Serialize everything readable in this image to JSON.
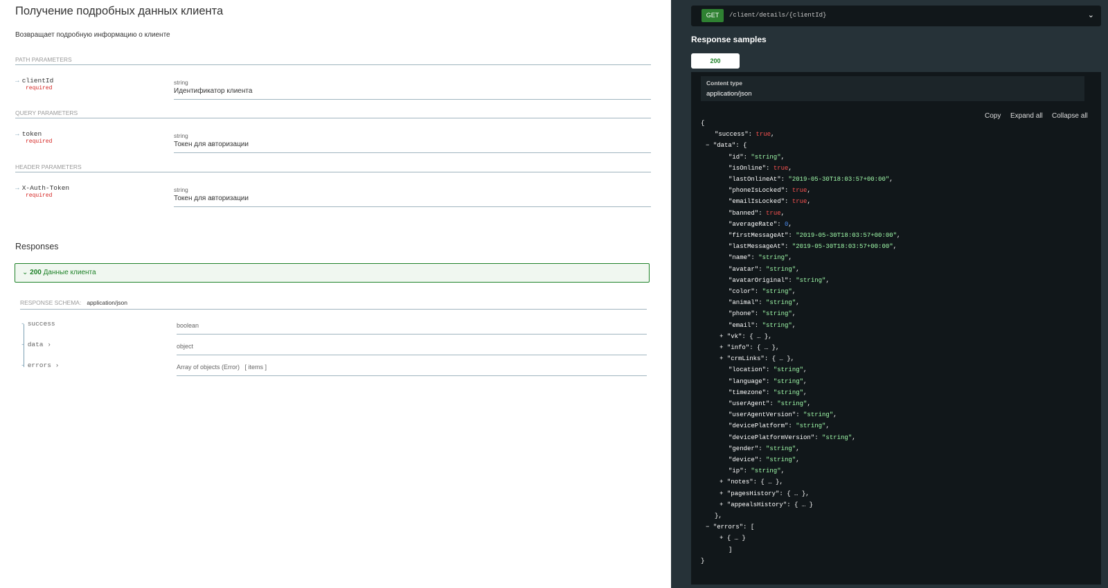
{
  "page": {
    "title": "Получение подробных данных клиента",
    "description": "Возвращает подробную информацию о клиенте"
  },
  "path_params": {
    "caption": "PATH PARAMETERS",
    "name": "clientId",
    "required": "required",
    "type": "string",
    "description": "Идентификатор клиента"
  },
  "query_params": {
    "caption": "QUERY PARAMETERS",
    "name": "token",
    "required": "required",
    "type": "string",
    "description": "Токен для авторизации"
  },
  "header_params": {
    "caption": "HEADER PARAMETERS",
    "name": "X-Auth-Token",
    "required": "required",
    "type": "string",
    "description": "Токен для авторизации"
  },
  "responses": {
    "title": "Responses",
    "code": "200",
    "label": "Данные клиента",
    "schema_label": "RESPONSE SCHEMA:",
    "schema_type": "application/json",
    "props": [
      {
        "name": "success",
        "type": "boolean"
      },
      {
        "name": "data",
        "type": "object"
      },
      {
        "name": "errors",
        "type": "Array of objects (Error)   [ items ]"
      }
    ]
  },
  "endpoint": {
    "method": "GET",
    "path": "/client/details/{clientId}"
  },
  "samples": {
    "title": "Response samples",
    "tab": "200",
    "content_type_label": "Content type",
    "content_type": "application/json",
    "copy": "Copy",
    "expand_all": "Expand all",
    "collapse_all": "Collapse all"
  },
  "json_lines": [
    {
      "indent": 0,
      "toggle": "",
      "text": "{"
    },
    {
      "indent": 1,
      "toggle": "",
      "key": "success",
      "val": "true",
      "vt": "b",
      "comma": true
    },
    {
      "indent": 1,
      "toggle": "−",
      "key": "data",
      "val": "{",
      "vt": "k",
      "comma": false
    },
    {
      "indent": 2,
      "toggle": "",
      "key": "id",
      "val": "\"string\"",
      "vt": "s",
      "comma": true
    },
    {
      "indent": 2,
      "toggle": "",
      "key": "isOnline",
      "val": "true",
      "vt": "b",
      "comma": true
    },
    {
      "indent": 2,
      "toggle": "",
      "key": "lastOnlineAt",
      "val": "\"2019-05-30T18:03:57+00:00\"",
      "vt": "s",
      "comma": true
    },
    {
      "indent": 2,
      "toggle": "",
      "key": "phoneIsLocked",
      "val": "true",
      "vt": "b",
      "comma": true
    },
    {
      "indent": 2,
      "toggle": "",
      "key": "emailIsLocked",
      "val": "true",
      "vt": "b",
      "comma": true
    },
    {
      "indent": 2,
      "toggle": "",
      "key": "banned",
      "val": "true",
      "vt": "b",
      "comma": true
    },
    {
      "indent": 2,
      "toggle": "",
      "key": "averageRate",
      "val": "0",
      "vt": "n",
      "comma": true
    },
    {
      "indent": 2,
      "toggle": "",
      "key": "firstMessageAt",
      "val": "\"2019-05-30T18:03:57+00:00\"",
      "vt": "s",
      "comma": true
    },
    {
      "indent": 2,
      "toggle": "",
      "key": "lastMessageAt",
      "val": "\"2019-05-30T18:03:57+00:00\"",
      "vt": "s",
      "comma": true
    },
    {
      "indent": 2,
      "toggle": "",
      "key": "name",
      "val": "\"string\"",
      "vt": "s",
      "comma": true
    },
    {
      "indent": 2,
      "toggle": "",
      "key": "avatar",
      "val": "\"string\"",
      "vt": "s",
      "comma": true
    },
    {
      "indent": 2,
      "toggle": "",
      "key": "avatarOriginal",
      "val": "\"string\"",
      "vt": "s",
      "comma": true
    },
    {
      "indent": 2,
      "toggle": "",
      "key": "color",
      "val": "\"string\"",
      "vt": "s",
      "comma": true
    },
    {
      "indent": 2,
      "toggle": "",
      "key": "animal",
      "val": "\"string\"",
      "vt": "s",
      "comma": true
    },
    {
      "indent": 2,
      "toggle": "",
      "key": "phone",
      "val": "\"string\"",
      "vt": "s",
      "comma": true
    },
    {
      "indent": 2,
      "toggle": "",
      "key": "email",
      "val": "\"string\"",
      "vt": "s",
      "comma": true
    },
    {
      "indent": 2,
      "toggle": "+",
      "key": "vk",
      "val": "{ … }",
      "vt": "k",
      "comma": true
    },
    {
      "indent": 2,
      "toggle": "+",
      "key": "info",
      "val": "{ … }",
      "vt": "k",
      "comma": true
    },
    {
      "indent": 2,
      "toggle": "+",
      "key": "crmLinks",
      "val": "{ … }",
      "vt": "k",
      "comma": true
    },
    {
      "indent": 2,
      "toggle": "",
      "key": "location",
      "val": "\"string\"",
      "vt": "s",
      "comma": true
    },
    {
      "indent": 2,
      "toggle": "",
      "key": "language",
      "val": "\"string\"",
      "vt": "s",
      "comma": true
    },
    {
      "indent": 2,
      "toggle": "",
      "key": "timezone",
      "val": "\"string\"",
      "vt": "s",
      "comma": true
    },
    {
      "indent": 2,
      "toggle": "",
      "key": "userAgent",
      "val": "\"string\"",
      "vt": "s",
      "comma": true
    },
    {
      "indent": 2,
      "toggle": "",
      "key": "userAgentVersion",
      "val": "\"string\"",
      "vt": "s",
      "comma": true
    },
    {
      "indent": 2,
      "toggle": "",
      "key": "devicePlatform",
      "val": "\"string\"",
      "vt": "s",
      "comma": true
    },
    {
      "indent": 2,
      "toggle": "",
      "key": "devicePlatformVersion",
      "val": "\"string\"",
      "vt": "s",
      "comma": true
    },
    {
      "indent": 2,
      "toggle": "",
      "key": "gender",
      "val": "\"string\"",
      "vt": "s",
      "comma": true
    },
    {
      "indent": 2,
      "toggle": "",
      "key": "device",
      "val": "\"string\"",
      "vt": "s",
      "comma": true
    },
    {
      "indent": 2,
      "toggle": "",
      "key": "ip",
      "val": "\"string\"",
      "vt": "s",
      "comma": true
    },
    {
      "indent": 2,
      "toggle": "+",
      "key": "notes",
      "val": "{ … }",
      "vt": "k",
      "comma": true
    },
    {
      "indent": 2,
      "toggle": "+",
      "key": "pagesHistory",
      "val": "{ … }",
      "vt": "k",
      "comma": true
    },
    {
      "indent": 2,
      "toggle": "+",
      "key": "appealsHistory",
      "val": "{ … }",
      "vt": "k",
      "comma": false
    },
    {
      "indent": 1,
      "toggle": "",
      "text": "},"
    },
    {
      "indent": 1,
      "toggle": "−",
      "key": "errors",
      "val": "[",
      "vt": "k",
      "comma": false
    },
    {
      "indent": 2,
      "toggle": "+",
      "text": "{ … }"
    },
    {
      "indent": 2,
      "toggle": "",
      "text": "]"
    },
    {
      "indent": 0,
      "toggle": "",
      "text": "}"
    }
  ]
}
